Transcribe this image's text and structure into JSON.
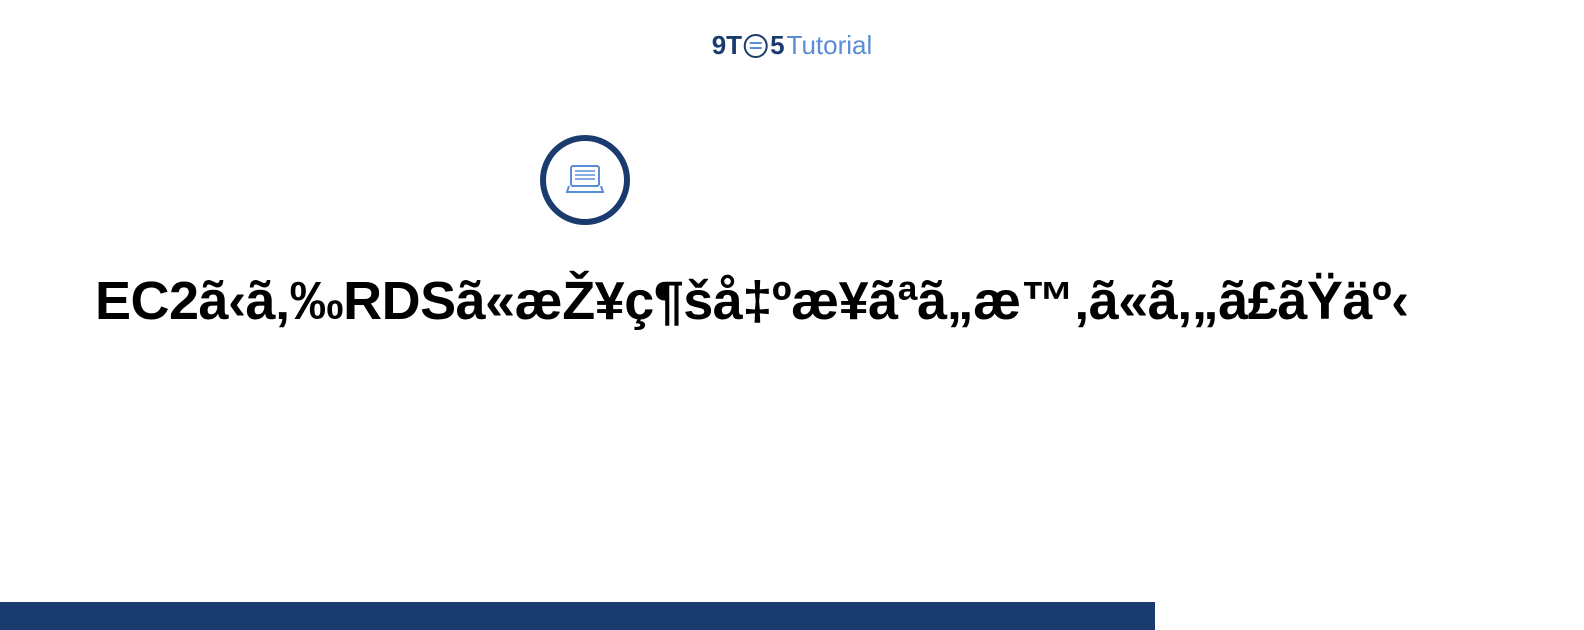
{
  "logo": {
    "part1": "9T",
    "part2": "5",
    "part3": "Tutorial"
  },
  "title": "EC2ã‹ã‚‰RDSã«æŽ¥ç¶šå‡ºæ¥ãªã„æ™‚ã«ã‚„ã£ãŸäº‹",
  "colors": {
    "brand_dark": "#1a3b6e",
    "brand_light": "#5b8dd6"
  }
}
